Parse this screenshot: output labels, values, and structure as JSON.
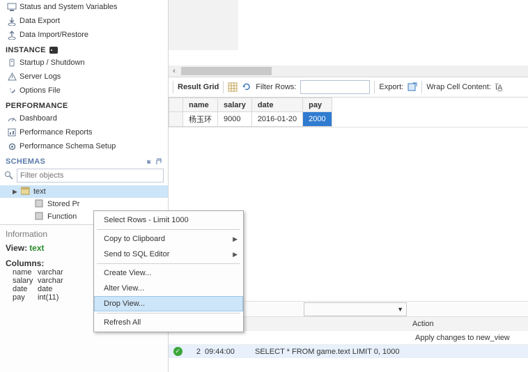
{
  "sidebar": {
    "management": [
      {
        "label": "Status and System Variables",
        "icon": "monitor-icon"
      },
      {
        "label": "Data Export",
        "icon": "export-icon"
      },
      {
        "label": "Data Import/Restore",
        "icon": "import-icon"
      }
    ],
    "instance_title": "INSTANCE",
    "instance": [
      {
        "label": "Startup / Shutdown",
        "icon": "power-icon"
      },
      {
        "label": "Server Logs",
        "icon": "warning-icon"
      },
      {
        "label": "Options File",
        "icon": "wrench-icon"
      }
    ],
    "performance_title": "PERFORMANCE",
    "performance": [
      {
        "label": "Dashboard",
        "icon": "gauge-icon"
      },
      {
        "label": "Performance Reports",
        "icon": "report-icon"
      },
      {
        "label": "Performance Schema Setup",
        "icon": "gear-icon"
      }
    ],
    "schemas_title": "SCHEMAS",
    "filter_placeholder": "Filter objects",
    "tree": {
      "view": "text",
      "stored": "Stored Pr",
      "functions": "Function"
    }
  },
  "info": {
    "title": "Information",
    "view_label": "View:",
    "view_name": "text",
    "columns_label": "Columns:",
    "columns": [
      {
        "name": "name",
        "type": "varchar"
      },
      {
        "name": "salary",
        "type": "varchar"
      },
      {
        "name": "date",
        "type": "date"
      },
      {
        "name": "pay",
        "type": "int(11)"
      }
    ]
  },
  "toolbar": {
    "result_grid": "Result Grid",
    "filter_rows": "Filter Rows:",
    "export": "Export:",
    "wrap": "Wrap Cell Content:"
  },
  "grid": {
    "headers": [
      "name",
      "salary",
      "date",
      "pay"
    ],
    "row": {
      "name": "杨玉环",
      "salary": "9000",
      "date": "2016-01-20",
      "pay": "2000"
    }
  },
  "log": {
    "header_action": "Action",
    "rows": [
      {
        "idx": "",
        "time": "",
        "action": "Apply changes to new_view"
      },
      {
        "idx": "2",
        "time": "09:44:00",
        "action": "SELECT * FROM game.text LIMIT 0, 1000"
      }
    ]
  },
  "context_menu": {
    "items": [
      {
        "label": "Select Rows - Limit 1000",
        "sub": false
      },
      {
        "label": "Copy to Clipboard",
        "sub": true
      },
      {
        "label": "Send to SQL Editor",
        "sub": true
      },
      {
        "label": "Create View...",
        "sub": false
      },
      {
        "label": "Alter View...",
        "sub": false
      },
      {
        "label": "Drop View...",
        "sub": false,
        "hover": true
      },
      {
        "label": "Refresh All",
        "sub": false
      }
    ]
  }
}
